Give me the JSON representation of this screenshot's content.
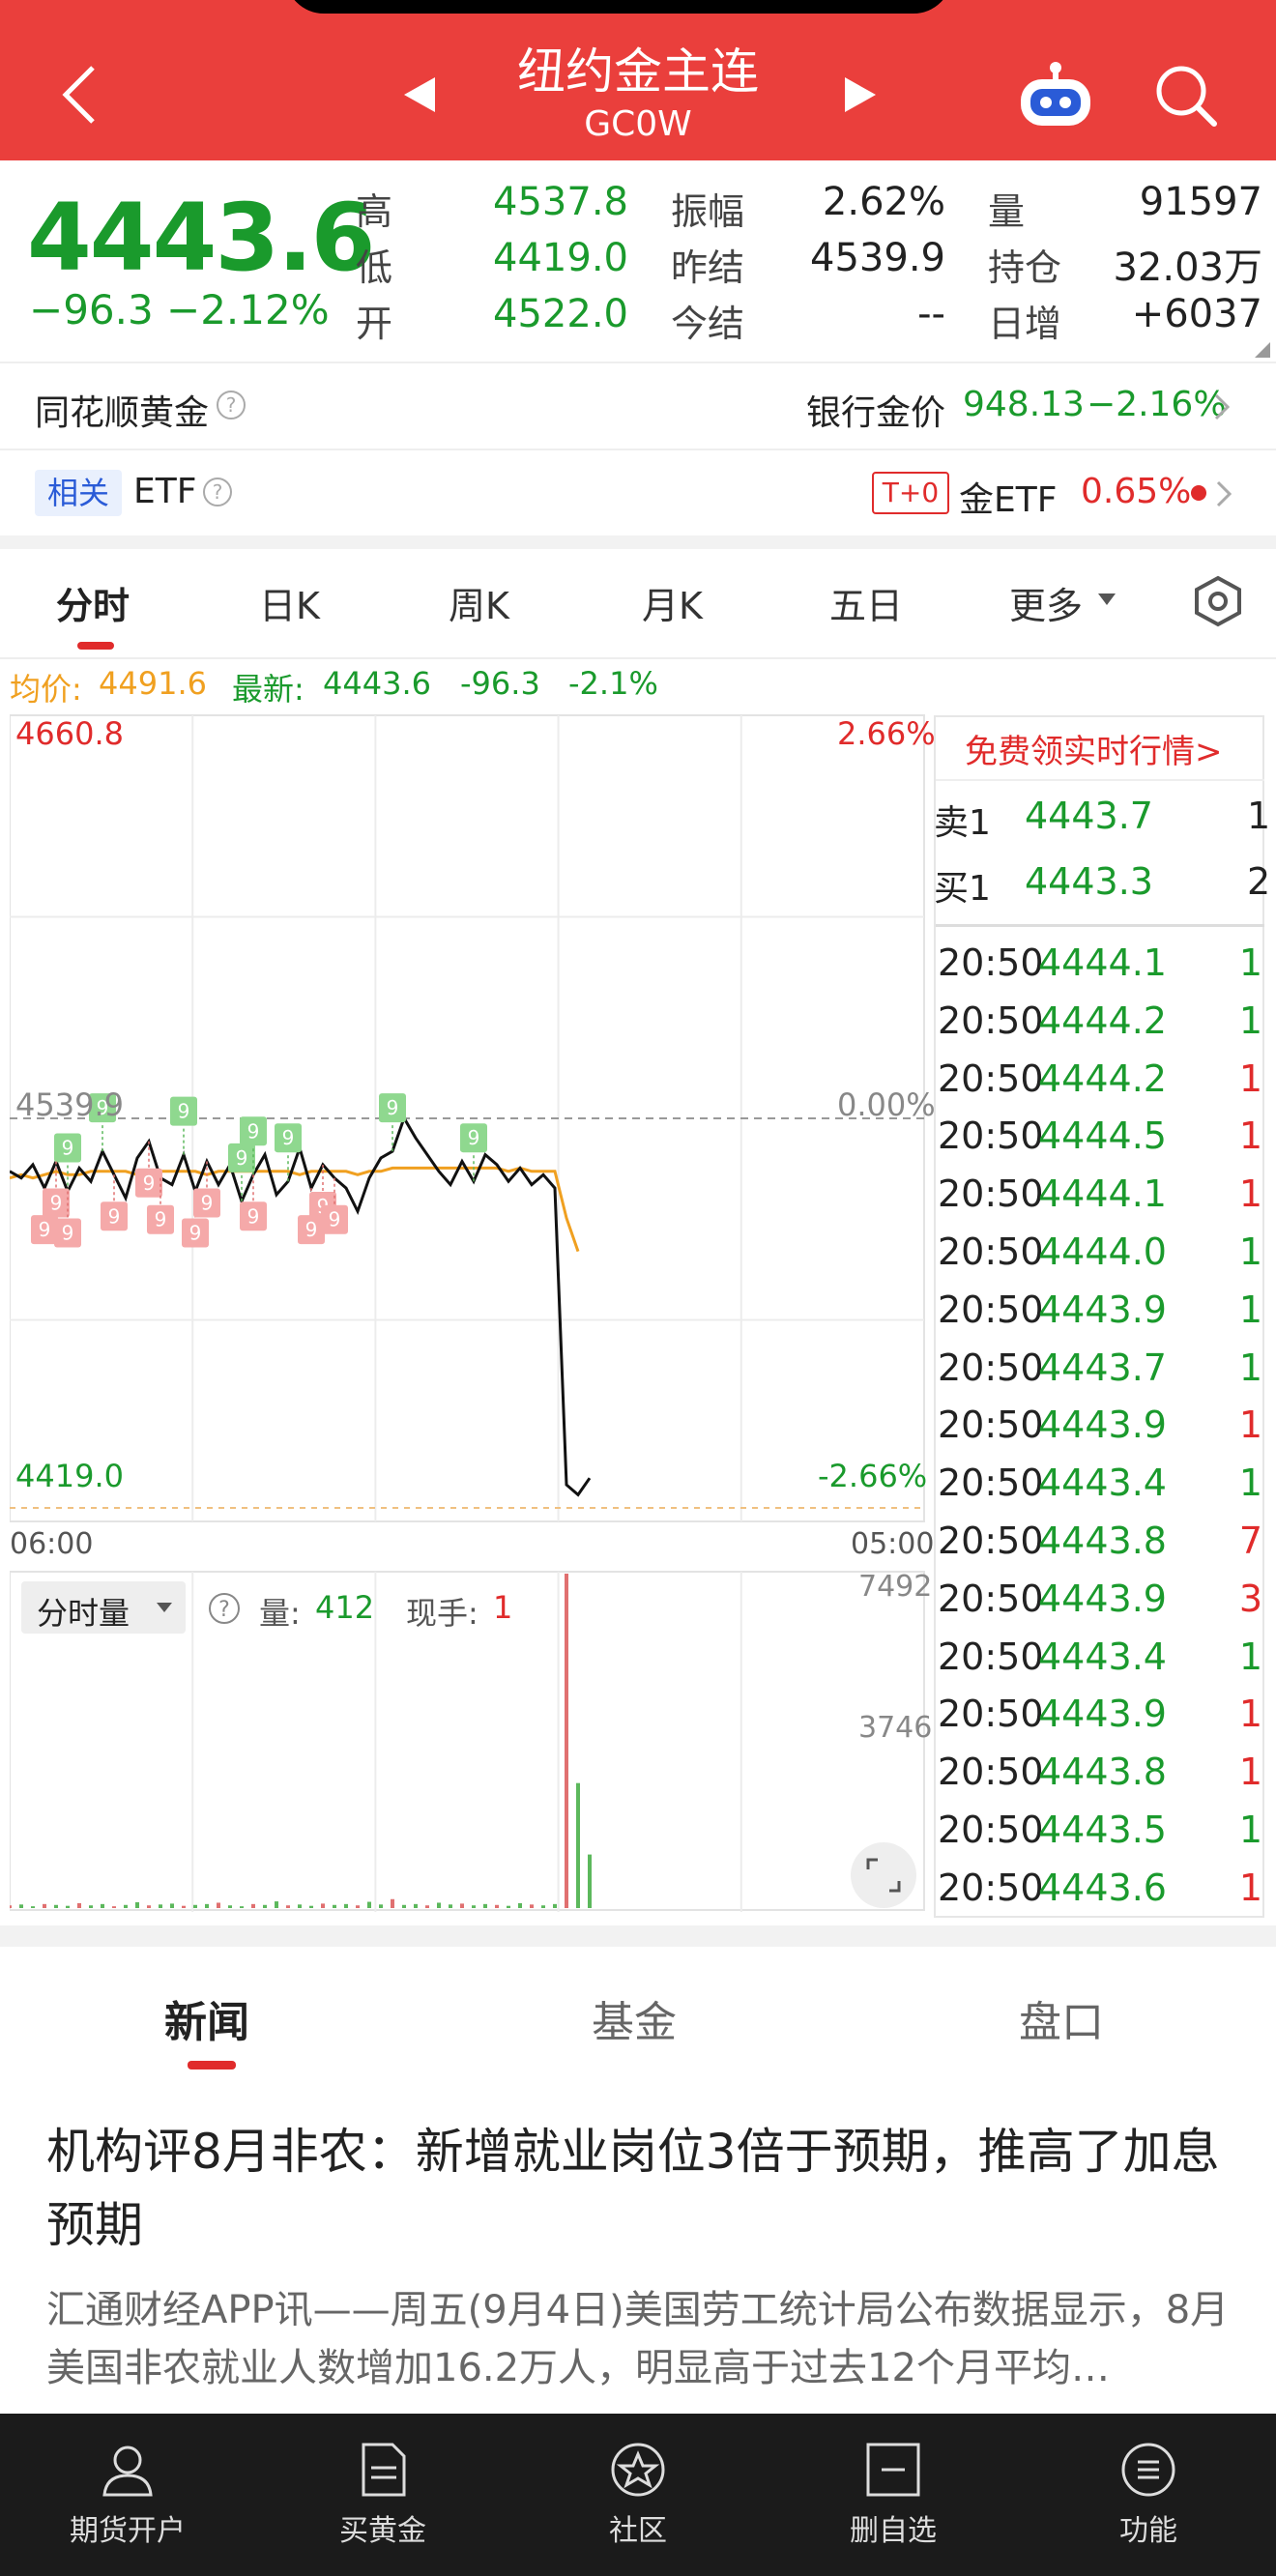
{
  "header": {
    "title": "纽约金主连",
    "code": "GC0W"
  },
  "quote": {
    "price": "4443.6",
    "change": "−96.3",
    "change_pct": "−2.12%",
    "stats": [
      {
        "label": "高",
        "value": "4537.8"
      },
      {
        "label": "低",
        "value": "4419.0"
      },
      {
        "label": "开",
        "value": "4522.0"
      },
      {
        "label": "振幅",
        "value": "2.62%"
      },
      {
        "label": "昨结",
        "value": "4539.9"
      },
      {
        "label": "今结",
        "value": "--"
      },
      {
        "label": "量",
        "value": "91597"
      },
      {
        "label": "持仓",
        "value": "32.03万"
      },
      {
        "label": "日增",
        "value": "+6037"
      }
    ]
  },
  "gold_row": {
    "left": "同花顺黄金",
    "bank_label": "银行金价",
    "bank_price": "948.13",
    "bank_pct": "−2.16%"
  },
  "etf_row": {
    "tag": "相关",
    "label": "ETF",
    "t0": "T+0",
    "gold_etf": "金ETF",
    "gold_etf_pct": "0.65%"
  },
  "kline_tabs": [
    "分时",
    "日K",
    "周K",
    "月K",
    "五日",
    "更多"
  ],
  "avg_line": {
    "avg_label": "均价:",
    "avg": "4491.6",
    "latest_label": "最新:",
    "latest": "4443.6",
    "chg": "-96.3",
    "pct": "-2.1%"
  },
  "chart_data": {
    "type": "line",
    "y_top": "4660.8",
    "y_mid": "4539.9",
    "y_bottom": "4419.0",
    "pct_top": "2.66%",
    "pct_mid": "0.00%",
    "pct_bottom": "-2.66%",
    "x_start": "06:00",
    "x_end": "05:00",
    "ylim": [
      4419.0,
      4660.8
    ],
    "series": [
      {
        "values": [
          4524,
          4522,
          4526,
          4519,
          4527,
          4518,
          4525,
          4521,
          4530,
          4523,
          4516,
          4528,
          4533,
          4522,
          4520,
          4529,
          4518,
          4527,
          4520,
          4526,
          4515,
          4523,
          4529,
          4517,
          4521,
          4531,
          4519,
          4526,
          4522,
          4519,
          4512,
          4522,
          4528,
          4530,
          4540,
          4534,
          4529,
          4524,
          4520,
          4527,
          4521,
          4529,
          4526,
          4521,
          4525,
          4520,
          4523,
          4519,
          4430,
          4427,
          4432
        ]
      },
      {
        "values": [
          4522,
          4523,
          4522,
          4523,
          4524,
          4523,
          4523,
          4524,
          4524,
          4524,
          4524,
          4523,
          4524,
          4524,
          4524,
          4524,
          4524,
          4523,
          4524,
          4524,
          4524,
          4524,
          4524,
          4524,
          4524,
          4523,
          4524,
          4524,
          4524,
          4524,
          4523,
          4524,
          4524,
          4525,
          4525,
          4525,
          4525,
          4525,
          4525,
          4525,
          4525,
          4525,
          4525,
          4524,
          4525,
          4524,
          4524,
          4524,
          4510,
          4500
        ]
      }
    ],
    "volume": {
      "label": "分时量",
      "qty_label": "量:",
      "qty": "412",
      "hand_label": "现手:",
      "hand": "1",
      "max_label": "7492",
      "mid_label": "3746",
      "ylim": [
        0,
        7492
      ],
      "values": [
        60,
        80,
        40,
        90,
        70,
        50,
        110,
        60,
        90,
        40,
        70,
        130,
        60,
        80,
        100,
        50,
        70,
        90,
        120,
        60,
        40,
        90,
        70,
        150,
        60,
        80,
        50,
        100,
        70,
        90,
        60,
        140,
        80,
        200,
        70,
        90,
        60,
        120,
        80,
        100,
        60,
        90,
        70,
        50,
        110,
        80,
        60,
        90,
        7492,
        2800,
        1200
      ]
    }
  },
  "order_book": {
    "promo": "免费领实时行情>",
    "ask_label": "卖1",
    "ask_price": "4443.7",
    "ask_qty": "1",
    "bid_label": "买1",
    "bid_price": "4443.3",
    "bid_qty": "2",
    "ticks": [
      {
        "time": "20:50",
        "price": "4444.1",
        "qty": "1",
        "color": "#1a9a2c"
      },
      {
        "time": "20:50",
        "price": "4444.2",
        "qty": "1",
        "color": "#1a9a2c"
      },
      {
        "time": "20:50",
        "price": "4444.2",
        "qty": "1",
        "color": "#e02b2b"
      },
      {
        "time": "20:50",
        "price": "4444.5",
        "qty": "1",
        "color": "#e02b2b"
      },
      {
        "time": "20:50",
        "price": "4444.1",
        "qty": "1",
        "color": "#e02b2b"
      },
      {
        "time": "20:50",
        "price": "4444.0",
        "qty": "1",
        "color": "#1a9a2c"
      },
      {
        "time": "20:50",
        "price": "4443.9",
        "qty": "1",
        "color": "#1a9a2c"
      },
      {
        "time": "20:50",
        "price": "4443.7",
        "qty": "1",
        "color": "#1a9a2c"
      },
      {
        "time": "20:50",
        "price": "4443.9",
        "qty": "1",
        "color": "#e02b2b"
      },
      {
        "time": "20:50",
        "price": "4443.4",
        "qty": "1",
        "color": "#1a9a2c"
      },
      {
        "time": "20:50",
        "price": "4443.8",
        "qty": "7",
        "color": "#e02b2b"
      },
      {
        "time": "20:50",
        "price": "4443.9",
        "qty": "3",
        "color": "#e02b2b"
      },
      {
        "time": "20:50",
        "price": "4443.4",
        "qty": "1",
        "color": "#1a9a2c"
      },
      {
        "time": "20:50",
        "price": "4443.9",
        "qty": "1",
        "color": "#e02b2b"
      },
      {
        "time": "20:50",
        "price": "4443.8",
        "qty": "1",
        "color": "#e02b2b"
      },
      {
        "time": "20:50",
        "price": "4443.5",
        "qty": "1",
        "color": "#1a9a2c"
      },
      {
        "time": "20:50",
        "price": "4443.6",
        "qty": "1",
        "color": "#e02b2b"
      }
    ]
  },
  "news_tabs": [
    "新闻",
    "基金",
    "盘口"
  ],
  "news": {
    "title": "机构评8月非农：新增就业岗位3倍于预期，推高了加息预期",
    "body": "汇通财经APP讯——周五(9月4日)美国劳工统计局公布数据显示，8月美国非农就业人数增加16.2万人，明显高于过去12个月平均…"
  },
  "bottom_nav": [
    "期货开户",
    "买黄金",
    "社区",
    "删自选",
    "功能"
  ],
  "colors": {
    "brand": "#ea3f3c",
    "up": "#e02b2b",
    "down": "#1a9a2c",
    "avg": "#f0a020"
  }
}
